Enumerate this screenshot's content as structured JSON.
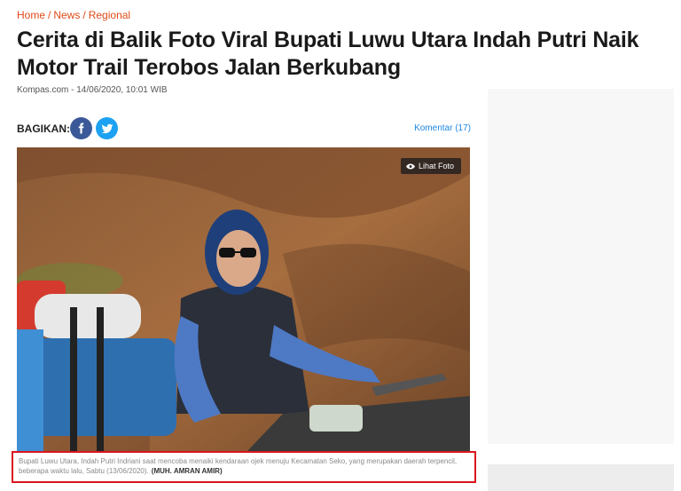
{
  "breadcrumb": {
    "home": "Home",
    "news": "News",
    "section": "Regional",
    "separator": "/"
  },
  "article": {
    "title": "Cerita di Balik Foto Viral Bupati Luwu Utara Indah Putri Naik Motor Trail Terobos Jalan Berkubang",
    "meta": "Kompas.com - 14/06/2020, 10:01 WIB"
  },
  "share": {
    "label": "BAGIKAN:",
    "facebook_icon": "facebook-icon",
    "twitter_icon": "twitter-icon",
    "comments": "Komentar (17)"
  },
  "photo": {
    "view_label": "Lihat Foto",
    "view_icon": "eye-icon",
    "caption": "Bupati Luwu Utara, Indah Putri Indriani saat mencoba menaiki kendaraan ojek menuju Kecamatan Seko, yang merupakan daerah terpencil, beberapa waktu lalu, Sabtu (13/06/2020).",
    "credit": "(MUH. AMRAN AMIR)"
  },
  "colors": {
    "accent": "#e04a19",
    "link": "#1e88e5",
    "facebook": "#3b5998",
    "twitter": "#1da1f2",
    "highlight": "#d9161f"
  }
}
